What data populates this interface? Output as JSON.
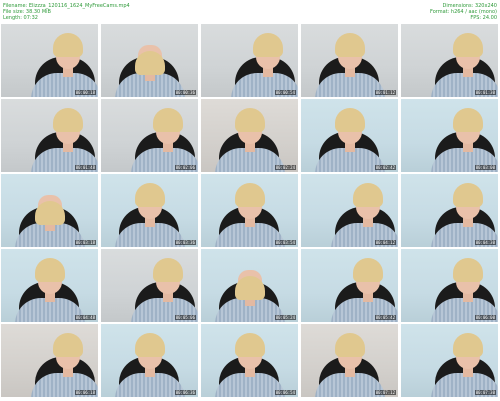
{
  "header": {
    "filename": "Filename: Elizzza_120116_1624_MyFreeCams.mp4",
    "filesize": "File size: 38.30 MiB",
    "length": "Length: 07:32",
    "dimensions": "Dimensions: 320x240",
    "format": "Format: h264 / aac (mono)",
    "fps": "FPS: 24.00"
  },
  "thumbnails": [
    {
      "time": "00:00:18"
    },
    {
      "time": "00:00:36"
    },
    {
      "time": "00:00:54"
    },
    {
      "time": "00:01:12"
    },
    {
      "time": "00:01:30"
    },
    {
      "time": "00:01:48"
    },
    {
      "time": "00:02:06"
    },
    {
      "time": "00:02:24"
    },
    {
      "time": "00:02:42"
    },
    {
      "time": "00:03:00"
    },
    {
      "time": "00:03:18"
    },
    {
      "time": "00:03:36"
    },
    {
      "time": "00:03:54"
    },
    {
      "time": "00:04:12"
    },
    {
      "time": "00:04:30"
    },
    {
      "time": "00:04:48"
    },
    {
      "time": "00:05:06"
    },
    {
      "time": "00:05:24"
    },
    {
      "time": "00:05:42"
    },
    {
      "time": "00:06:00"
    },
    {
      "time": "00:06:18"
    },
    {
      "time": "00:06:36"
    },
    {
      "time": "00:06:54"
    },
    {
      "time": "00:07:12"
    },
    {
      "time": "00:07:30"
    }
  ]
}
